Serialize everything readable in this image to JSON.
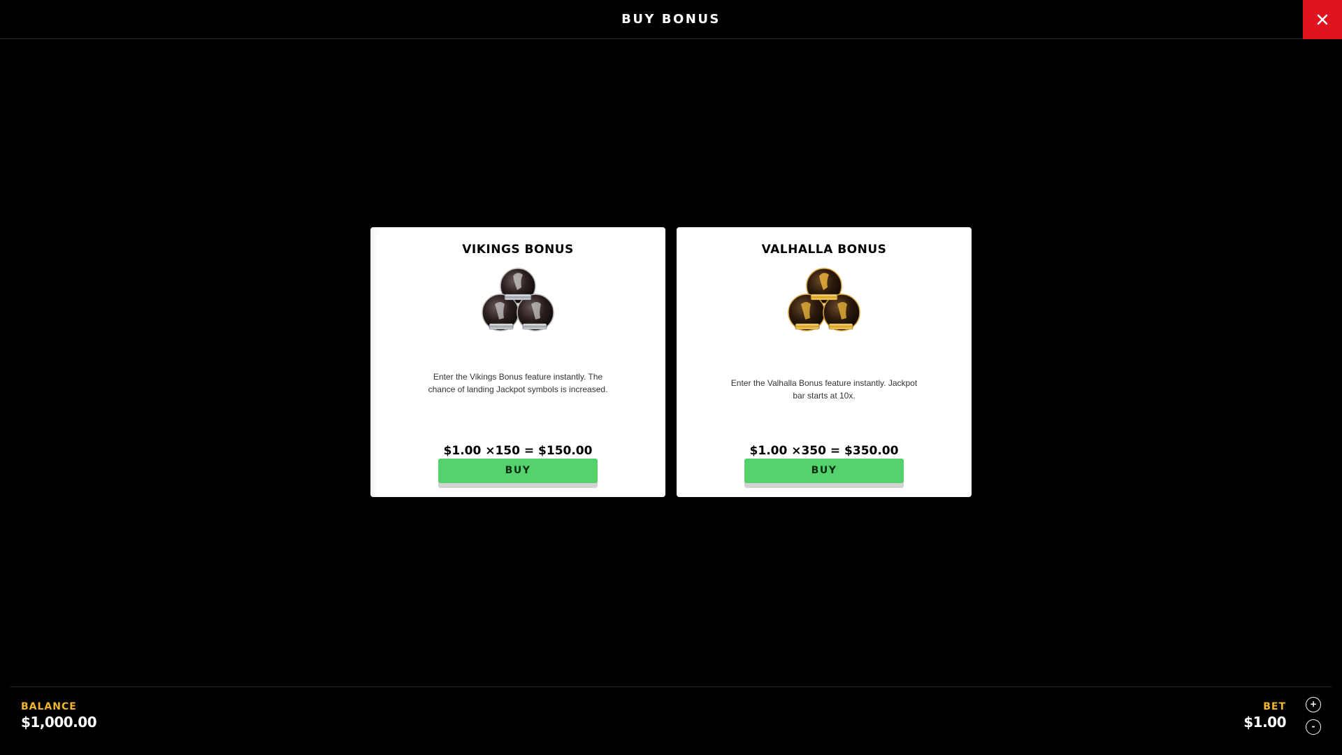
{
  "header": {
    "title": "BUY BONUS",
    "close_icon": "close-icon"
  },
  "bonuses": [
    {
      "title": "VIKINGS BONUS",
      "icon": "scatter-symbols-silver-icon",
      "description": "Enter the Vikings Bonus feature instantly. The chance of landing Jackpot symbols is increased.",
      "price": "$1.00 ×150 = $150.00",
      "buy_label": "BUY"
    },
    {
      "title": "VALHALLA BONUS",
      "icon": "scatter-symbols-gold-icon",
      "description": "Enter the Valhalla Bonus feature instantly. Jackpot bar starts at 10x.",
      "price": "$1.00 ×350 = $350.00",
      "buy_label": "BUY"
    }
  ],
  "footer": {
    "balance_label": "BALANCE",
    "balance_value": "$1,000.00",
    "bet_label": "BET",
    "bet_value": "$1.00",
    "increase_symbol": "+",
    "decrease_symbol": "-"
  },
  "colors": {
    "close_bg": "#e0141f",
    "buy_green": "#54d36c",
    "label_yellow": "#f2b52a",
    "background": "#000000"
  }
}
